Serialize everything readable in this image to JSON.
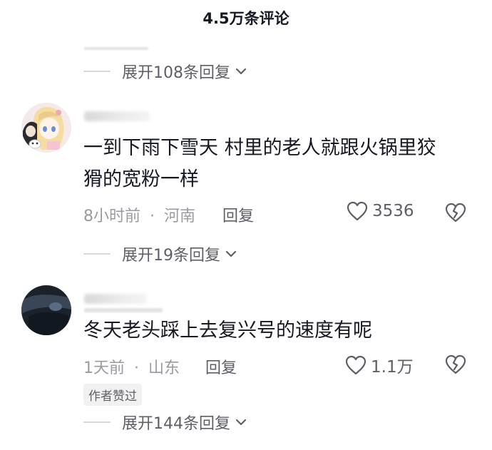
{
  "header": {
    "title": "4.5万条评论"
  },
  "threads": [
    {
      "expand_label": "展开108条回复"
    },
    {
      "comment_text_line1": "一到下雨下雪天 村里的老人就跟火锅里狡",
      "comment_text_line2": "猾的宽粉一样",
      "time": "8小时前",
      "location": "河南",
      "separator": "·",
      "reply_label": "回复",
      "like_count": "3536",
      "expand_label": "展开19条回复"
    },
    {
      "comment_text_line1": "冬天老头踩上去复兴号的速度有呢",
      "time": "1天前",
      "location": "山东",
      "separator": "·",
      "reply_label": "回复",
      "like_count": "1.1万",
      "author_badge": "作者赞过",
      "expand_label": "展开144条回复"
    }
  ],
  "icons": {
    "like": "heart-icon",
    "dislike": "broken-heart-icon",
    "expand": "chevron-down-icon"
  }
}
